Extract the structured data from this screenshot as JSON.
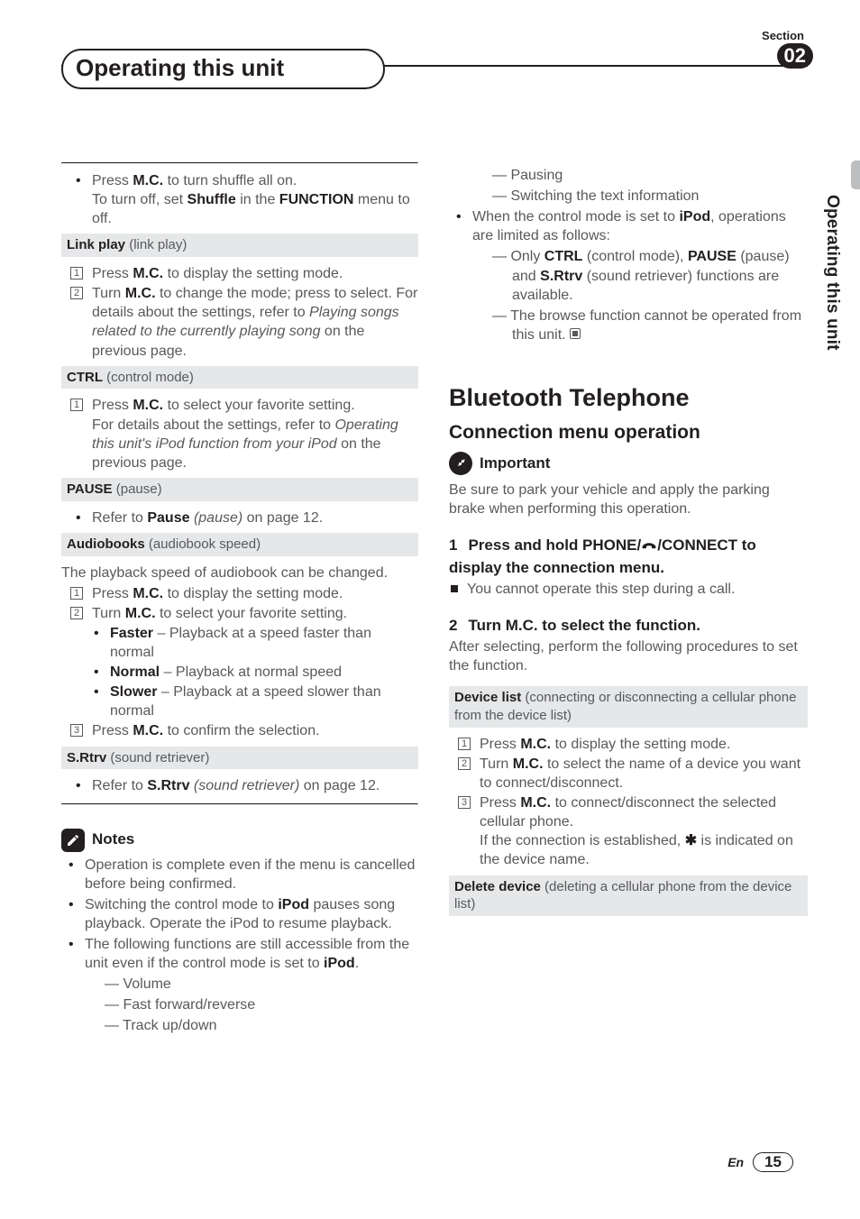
{
  "header": {
    "section_label": "Section",
    "section_number": "02",
    "title": "Operating this unit"
  },
  "sidetab": "Operating this unit",
  "left": {
    "shuffle": {
      "l1a": "Press ",
      "l1b": "M.C.",
      "l1c": " to turn shuffle all on.",
      "l2a": "To turn off, set ",
      "l2b": "Shuffle",
      "l2c": " in the ",
      "l2d": "FUNCTION",
      "l2e": " menu to off."
    },
    "link_play": {
      "head_b": "Link play",
      "head_r": " (link play)",
      "s1a": "Press ",
      "s1b": "M.C.",
      "s1c": " to display the setting mode.",
      "s2a": "Turn ",
      "s2b": "M.C.",
      "s2c": " to change the mode; press to select. For details about the settings, refer to ",
      "s2d": "Playing songs related to the currently playing song",
      "s2e": " on the previous page."
    },
    "ctrl": {
      "head_b": "CTRL",
      "head_r": " (control mode)",
      "s1a": "Press ",
      "s1b": "M.C.",
      "s1c": " to select your favorite setting.",
      "s1d": "For details about the settings, refer to ",
      "s1e": "Operating this unit's iPod function from your iPod",
      "s1f": " on the previous page."
    },
    "pause": {
      "head_b": "PAUSE",
      "head_r": " (pause)",
      "r1a": "Refer to ",
      "r1b": "Pause",
      "r1c": " (pause)",
      "r1d": " on page 12."
    },
    "audio": {
      "head_b": "Audiobooks",
      "head_r": " (audiobook speed)",
      "intro": "The playback speed of audiobook can be changed.",
      "s1a": "Press ",
      "s1b": "M.C.",
      "s1c": " to display the setting mode.",
      "s2a": "Turn ",
      "s2b": "M.C.",
      "s2c": " to select your favorite setting.",
      "opt1b": "Faster",
      "opt1r": " – Playback at a speed faster than normal",
      "opt2b": "Normal",
      "opt2r": " – Playback at normal speed",
      "opt3b": "Slower",
      "opt3r": " – Playback at a speed slower than normal",
      "s3a": "Press ",
      "s3b": "M.C.",
      "s3c": " to confirm the selection."
    },
    "srtrv": {
      "head_b": "S.Rtrv",
      "head_r": " (sound retriever)",
      "r1a": "Refer to ",
      "r1b": "S.Rtrv",
      "r1c": " (sound retriever)",
      "r1d": " on page 12."
    },
    "notes": {
      "title": "Notes",
      "n1": "Operation is complete even if the menu is cancelled before being confirmed.",
      "n2a": "Switching the control mode to ",
      "n2b": "iPod",
      "n2c": " pauses song playback. Operate the iPod to resume playback.",
      "n3a": "The following functions are still accessible from the unit even if the control mode is set to ",
      "n3b": "iPod",
      "n3c": ".",
      "d1": "Volume",
      "d2": "Fast forward/reverse",
      "d3": "Track up/down"
    }
  },
  "right": {
    "cont_dashes": {
      "d4": "Pausing",
      "d5": "Switching the text information"
    },
    "ipod": {
      "l1a": "When the control mode is set to ",
      "l1b": "iPod",
      "l1c": ", operations are limited as follows:",
      "d1a": "Only ",
      "d1b": "CTRL",
      "d1c": " (control mode), ",
      "d1d": "PAUSE",
      "d1e": " (pause) and ",
      "d1f": "S.Rtrv",
      "d1g": " (sound retriever) functions are available.",
      "d2": "The browse function cannot be operated from this unit."
    },
    "bt": {
      "h1": "Bluetooth Telephone",
      "h2": "Connection menu operation",
      "imp_label": "Important",
      "imp_text": "Be sure to park your vehicle and apply the parking brake when performing this operation.",
      "step1_num": "1",
      "step1a": "Press and hold PHONE/",
      "step1b": "/CONNECT to display the connection menu.",
      "step1_note": "You cannot operate this step during a call.",
      "step2_num": "2",
      "step2": "Turn M.C. to select the function.",
      "step2_body": "After selecting, perform the following procedures to set the function.",
      "devlist_b": "Device list",
      "devlist_r": " (connecting or disconnecting a cellular phone from the device list)",
      "dl1a": "Press ",
      "dl1b": "M.C.",
      "dl1c": " to display the setting mode.",
      "dl2a": "Turn ",
      "dl2b": "M.C.",
      "dl2c": " to select the name of a device you want to connect/disconnect.",
      "dl3a": "Press ",
      "dl3b": "M.C.",
      "dl3c": " to connect/disconnect the selected cellular phone.",
      "dl3d": "If the connection is established, ",
      "dl3e": "✱",
      "dl3f": " is indicated on the device name.",
      "deldev_b": "Delete device",
      "deldev_r": " (deleting a cellular phone from the device list)"
    }
  },
  "footer": {
    "lang": "En",
    "page": "15"
  }
}
